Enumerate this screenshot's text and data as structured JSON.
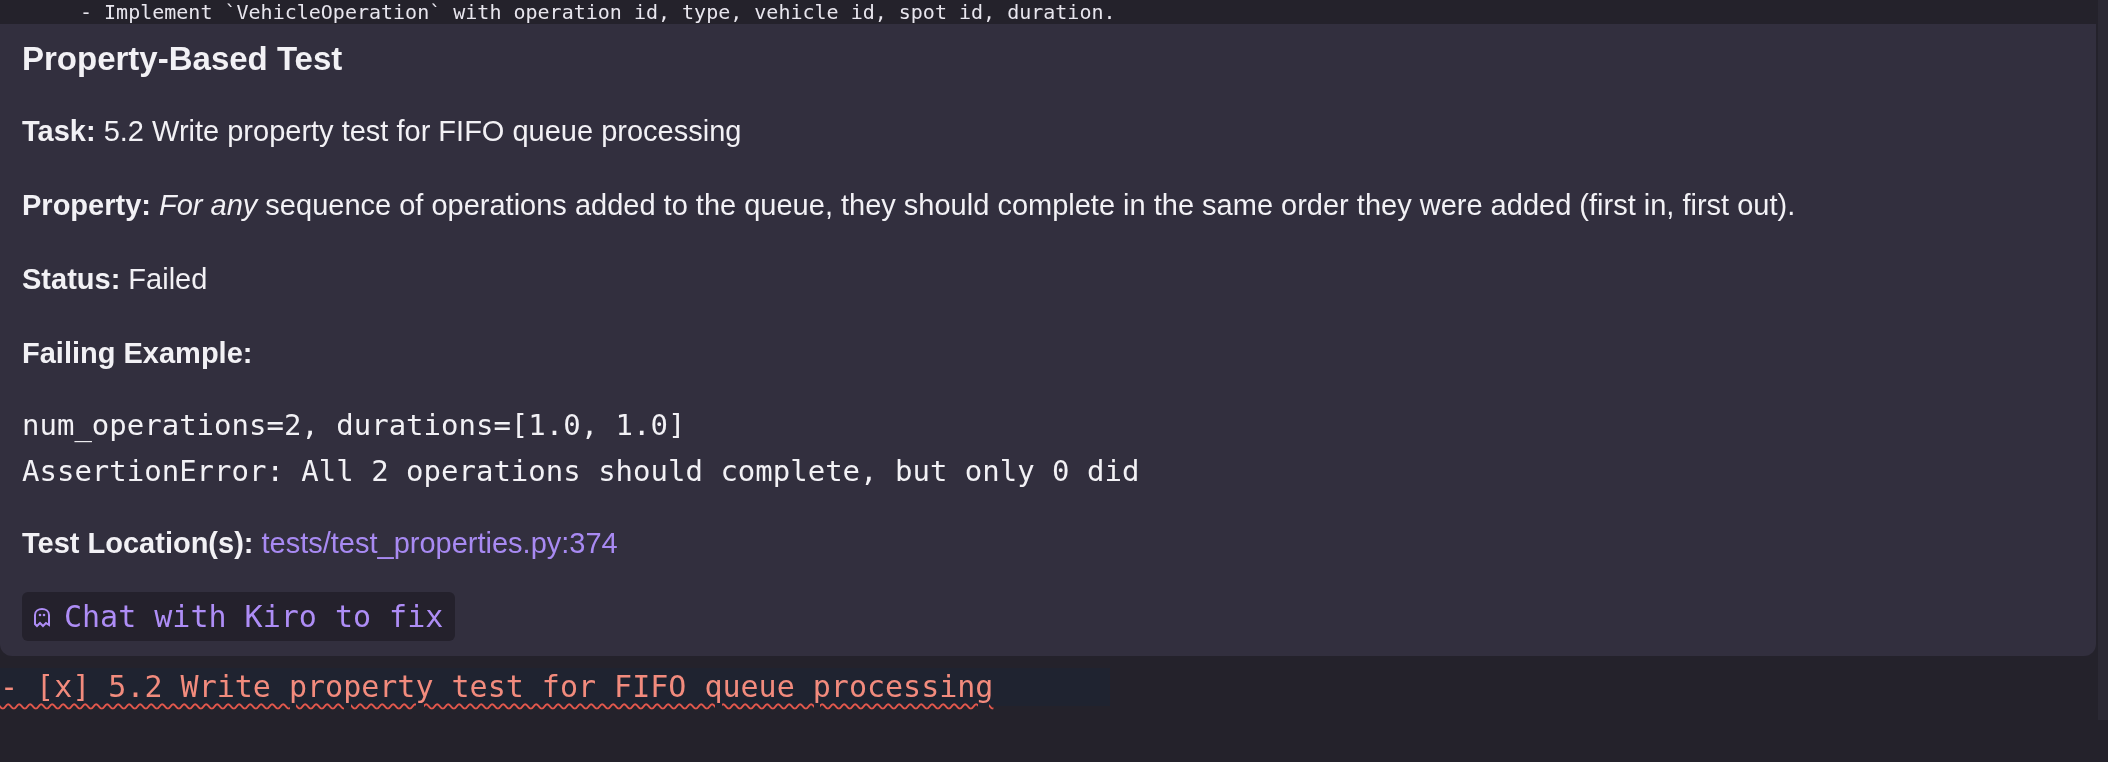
{
  "editor_top_line": {
    "text": "- Implement `VehicleOperation` with operation id, type, vehicle id, spot id, duration."
  },
  "hover": {
    "title": "Property-Based Test",
    "sections": [
      {
        "kind": "field",
        "label": "Task:",
        "value": "5.2 Write property test for FIFO queue processing"
      },
      {
        "kind": "field",
        "label": "Property:",
        "value": "*For any* sequence of operations added to the queue, they should complete in the same order they were added (first in, first out)."
      },
      {
        "kind": "field",
        "label": "Status:",
        "value": "Failed"
      },
      {
        "kind": "heading",
        "label": "Failing Example:"
      },
      {
        "kind": "code",
        "lines": [
          "num_operations=2, durations=[1.0, 1.0]",
          "AssertionError: All 2 operations should complete, but only 0 did"
        ]
      },
      {
        "kind": "link",
        "label": "Test Location(s):",
        "value": "tests/test_properties.py:374"
      }
    ],
    "action_button": {
      "label": "Chat with Kiro to fix"
    }
  },
  "editor_bottom_line": {
    "text": "- [x] 5.2 Write property test for FIFO queue processing",
    "error": true
  }
}
